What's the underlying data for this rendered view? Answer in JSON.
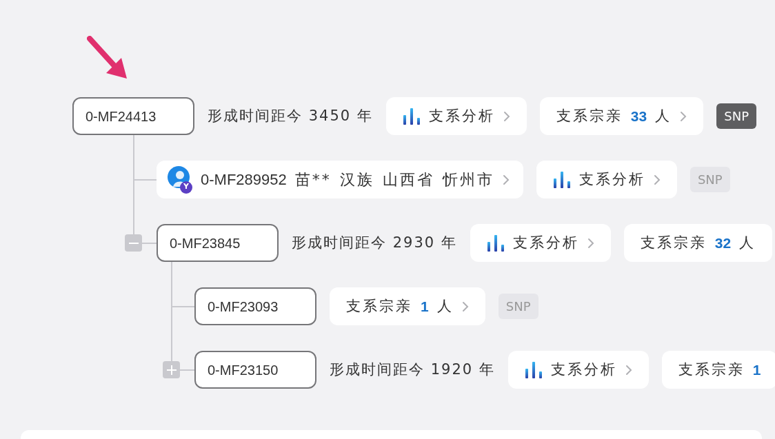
{
  "nodes": [
    {
      "kind": "haplogroup",
      "id": "0-MF24413",
      "age": "形成时间距今 3450 年",
      "actions": [
        {
          "kind": "analysis",
          "label": "支系分析",
          "chevron": true
        },
        {
          "kind": "relatives",
          "label": "支系宗亲",
          "count": "33",
          "unit": "人",
          "chevron": true
        },
        {
          "kind": "snp",
          "label": "SNP",
          "active": true
        }
      ],
      "children": [
        {
          "kind": "person",
          "badge": "Y",
          "parts": [
            "0-MF289952",
            "苗**",
            "汉族",
            "山西省",
            "忻州市"
          ],
          "actions": [
            {
              "kind": "analysis",
              "label": "支系分析",
              "chevron": true
            },
            {
              "kind": "snp",
              "label": "SNP",
              "active": false
            }
          ]
        },
        {
          "kind": "haplogroup",
          "id": "0-MF23845",
          "expanded": true,
          "age": "形成时间距今 2930 年",
          "actions": [
            {
              "kind": "analysis",
              "label": "支系分析",
              "chevron": true
            },
            {
              "kind": "relatives",
              "label": "支系宗亲",
              "count": "32",
              "unit": "人",
              "chevron": false
            }
          ],
          "children": [
            {
              "kind": "haplogroup",
              "id": "0-MF23093",
              "actions": [
                {
                  "kind": "relatives",
                  "label": "支系宗亲",
                  "count": "1",
                  "unit": "人",
                  "chevron": true
                },
                {
                  "kind": "snp",
                  "label": "SNP",
                  "active": false
                }
              ]
            },
            {
              "kind": "haplogroup",
              "id": "0-MF23150",
              "expanded": false,
              "age": "形成时间距今 1920 年",
              "actions": [
                {
                  "kind": "analysis",
                  "label": "支系分析",
                  "chevron": true
                },
                {
                  "kind": "relatives",
                  "label": "支系宗亲",
                  "count": "1",
                  "chevron": false
                }
              ]
            }
          ]
        }
      ]
    }
  ]
}
